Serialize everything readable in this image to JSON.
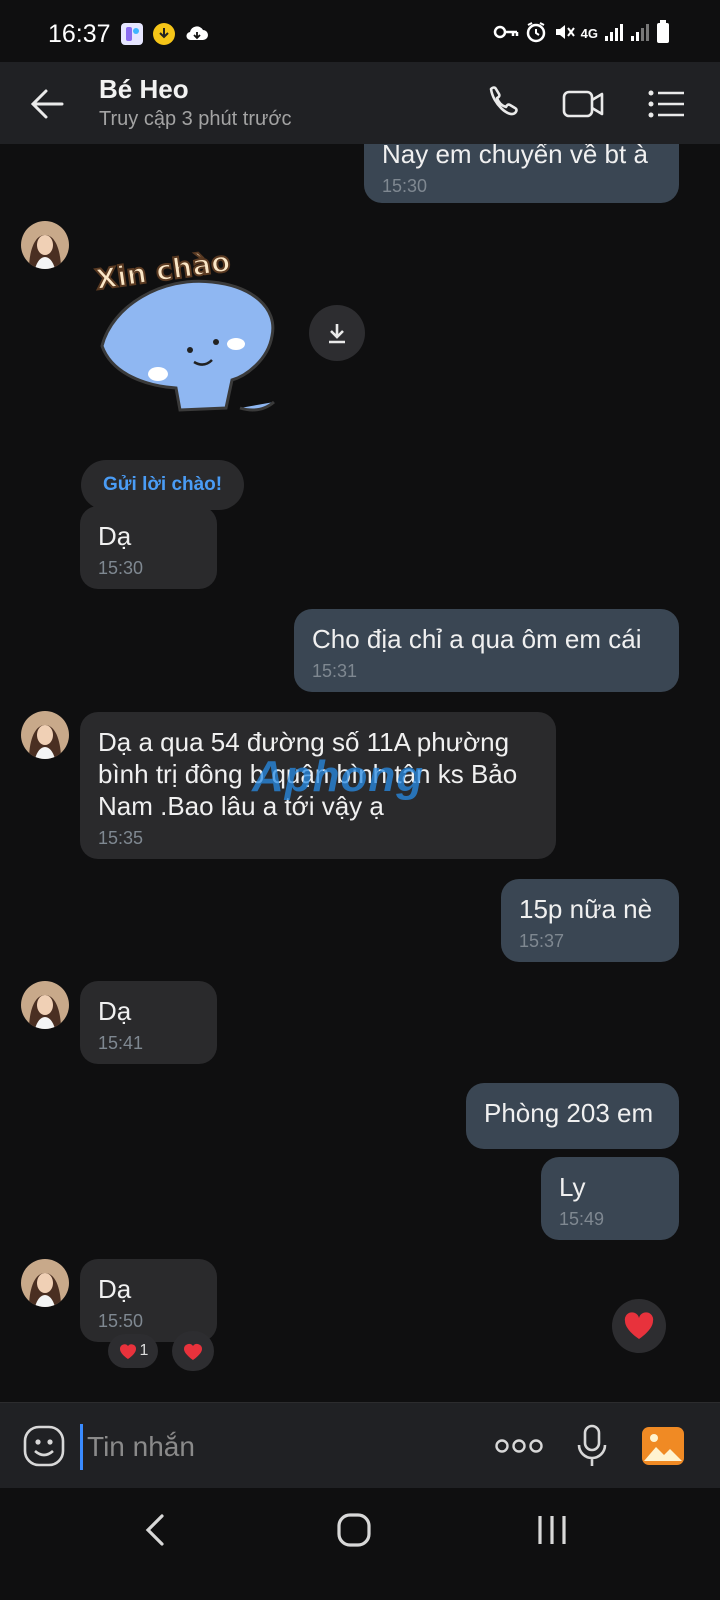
{
  "status_bar": {
    "time": "16:37",
    "network": "4G"
  },
  "header": {
    "contact_name": "Bé Heo",
    "contact_status": "Truy cập 3 phút trước",
    "icons": [
      "back-arrow-icon",
      "phone-icon",
      "video-icon",
      "menu-list-icon"
    ]
  },
  "sticker": {
    "text": "Xin chào",
    "greet_button": "Gửi lời chào!"
  },
  "messages": [
    {
      "dir": "out",
      "text": "Nay em chuyển về bt à",
      "time": "15:30"
    },
    {
      "dir": "in",
      "text": "Dạ",
      "time": "15:30"
    },
    {
      "dir": "out",
      "text": "Cho địa chỉ a qua ôm em cái",
      "time": "15:31"
    },
    {
      "dir": "in",
      "text": "Dạ a qua 54 đường số 11A phường bình trị đông b quận bình tân ks Bảo Nam .Bao lâu a tới vậy ạ",
      "time": "15:35"
    },
    {
      "dir": "out",
      "text": "15p nữa nè",
      "time": "15:37"
    },
    {
      "dir": "in",
      "text": "Dạ",
      "time": "15:41"
    },
    {
      "dir": "out",
      "text": "Phòng 203 em",
      "time": ""
    },
    {
      "dir": "out",
      "text": "Ly",
      "time": "15:49"
    },
    {
      "dir": "in",
      "text": "Dạ",
      "time": "15:50"
    }
  ],
  "reactions": {
    "count": "1"
  },
  "composer": {
    "placeholder": "Tin nhắn"
  },
  "watermark": "Aphong",
  "colors": {
    "accent": "#4a9cf5",
    "incoming_bubble": "#2a2a2c",
    "outgoing_bubble": "#3a4653",
    "heart": "#e8323c"
  }
}
